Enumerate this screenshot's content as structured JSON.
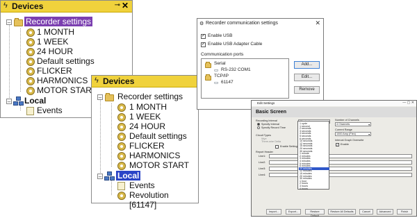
{
  "left_panel": {
    "title": "Devices",
    "pin": "⊸",
    "close": "✕",
    "tree": [
      {
        "label": "Recorder settings",
        "type": "settings",
        "expanded": "–"
      },
      {
        "label": "1 MONTH",
        "type": "gear"
      },
      {
        "label": "1 WEEK",
        "type": "gear"
      },
      {
        "label": "24 HOUR",
        "type": "gear"
      },
      {
        "label": "Default settings",
        "type": "gear"
      },
      {
        "label": "FLICKER",
        "type": "gear"
      },
      {
        "label": "HARMONICS",
        "type": "gear"
      },
      {
        "label": "MOTOR START",
        "type": "gear"
      },
      {
        "label": "Local",
        "type": "network",
        "expanded": "–"
      },
      {
        "label": "Events",
        "type": "events"
      }
    ]
  },
  "mid_panel": {
    "title": "Devices",
    "tree": [
      {
        "label": "Recorder settings",
        "type": "settings",
        "expanded": "–"
      },
      {
        "label": "1 MONTH",
        "type": "gear"
      },
      {
        "label": "1 WEEK",
        "type": "gear"
      },
      {
        "label": "24 HOUR",
        "type": "gear"
      },
      {
        "label": "Default settings",
        "type": "gear"
      },
      {
        "label": "FLICKER",
        "type": "gear"
      },
      {
        "label": "HARMONICS",
        "type": "gear"
      },
      {
        "label": "MOTOR START",
        "type": "gear"
      },
      {
        "label": "Local",
        "type": "network",
        "expanded": "–"
      },
      {
        "label": "Events",
        "type": "events"
      },
      {
        "label": "Revolution [61147]",
        "type": "device"
      }
    ]
  },
  "comm_dialog": {
    "title": "Recorder communication settings",
    "enable_usb": "Enable USB",
    "enable_usb_adapter": "Enable USB Adapter Cable",
    "ports_label": "Communication ports",
    "ports": [
      {
        "label": "Serial",
        "type": "folder"
      },
      {
        "label": "RS-232 COM1",
        "type": "port"
      },
      {
        "label": "TCP/IP",
        "type": "folder"
      },
      {
        "label": "61147",
        "type": "port"
      }
    ],
    "buttons": {
      "add": "Add...",
      "edit": "Edit...",
      "remove": "Remove"
    }
  },
  "edit_settings": {
    "title": "Edit Settings",
    "header": "Basic Screen",
    "recording_interval_label": "Recording Interval",
    "specify_interval": "Specify Interval",
    "specify_record_time": "Specify Record Time",
    "interval_value": "10 minutes",
    "circuit_types_label": "Circuit Types",
    "circuit_opt1": "Wye",
    "circuit_opt2": "Three-wire Delta",
    "enable_settings": "Enable Settings",
    "report_header_label": "Report Header",
    "lines": [
      "Line1:",
      "Line2:",
      "Line3:",
      "Line4:"
    ],
    "number_of_channels_label": "Number of Channels",
    "channels_value": "4 Channels",
    "current_range_label": "Current Range",
    "current_range_value": "1000 Amp (Flex)",
    "interval_graph_label": "Interval Graph Overwrite",
    "enable": "Enable",
    "dropdown_items": [
      "1 cycle",
      "1 second",
      "2 seconds",
      "3 seconds",
      "4 seconds",
      "5 seconds",
      "6 seconds",
      "10 seconds",
      "12 seconds",
      "15 seconds",
      "20 seconds",
      "30 seconds",
      "1 minute",
      "2 minutes",
      "3 minutes",
      "4 minutes",
      "5 minutes",
      "6 minutes",
      "10 minutes",
      "12 minutes",
      "15 minutes",
      "20 minutes",
      "30 minutes",
      "1 hour",
      "2 hours",
      "3 hours",
      "4 hours"
    ],
    "dropdown_selected_index": 18,
    "buttons": [
      "Import...",
      "Export...",
      "Restore Default",
      "Restore All Defaults",
      "Cancel",
      "Advanced",
      "Finish"
    ]
  }
}
